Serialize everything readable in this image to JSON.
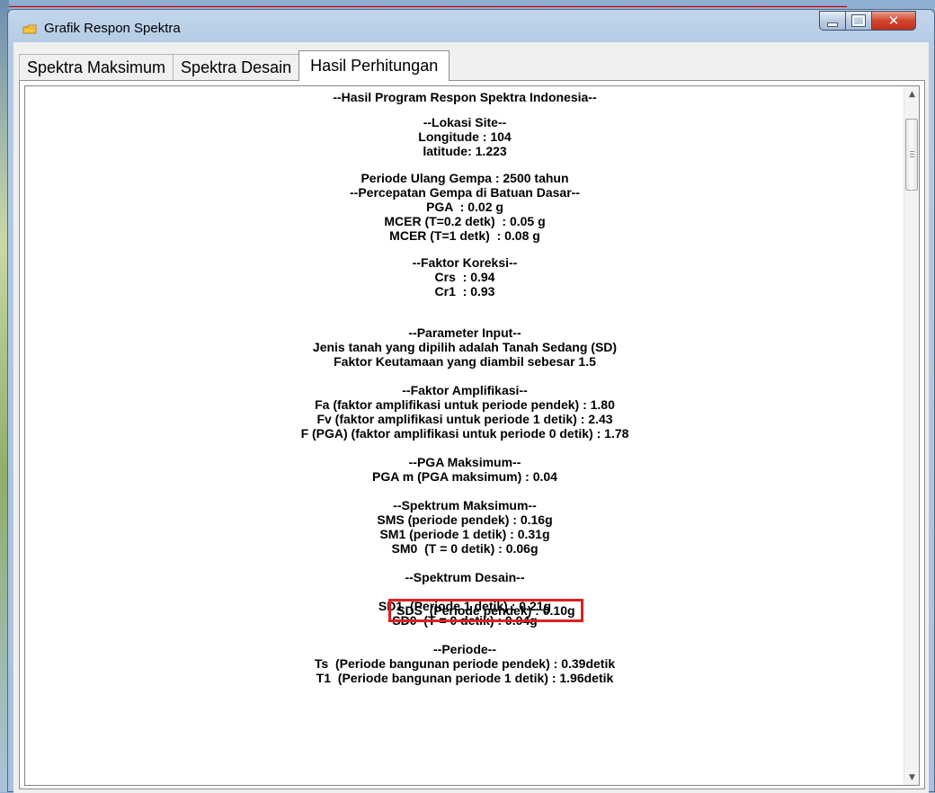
{
  "window": {
    "title": "Grafik Respon Spektra"
  },
  "tabs": [
    {
      "label": "Spektra Maksimum"
    },
    {
      "label": "Spektra Desain"
    },
    {
      "label": "Hasil Perhitungan"
    }
  ],
  "results": {
    "header": "--Hasil Program Respon Spektra Indonesia--",
    "lokasi_heading": "--Lokasi Site--",
    "longitude": "Longitude : 104",
    "latitude": "latitude: 1.223",
    "periode_ulang": "Periode Ulang Gempa : 2500 tahun",
    "percepatan_heading": "--Percepatan Gempa di Batuan Dasar--",
    "pga": "PGA  : 0.02 g",
    "mcer_02": "MCER (T=0.2 detk)  : 0.05 g",
    "mcer_1": "MCER (T=1 detk)  : 0.08 g",
    "koreksi_heading": "--Faktor Koreksi--",
    "crs": "Crs  : 0.94",
    "cr1": "Cr1  : 0.93",
    "input_heading": "--Parameter Input--",
    "jenis_tanah": "Jenis tanah yang dipilih adalah Tanah Sedang (SD)",
    "faktor_keutamaan": "Faktor Keutamaan yang diambil sebesar 1.5",
    "amplifikasi_heading": "--Faktor Amplifikasi--",
    "fa": "Fa (faktor amplifikasi untuk periode pendek) : 1.80",
    "fv": "Fv (faktor amplifikasi untuk periode 1 detik) : 2.43",
    "fpga": "F (PGA) (faktor amplifikasi untuk periode 0 detik) : 1.78",
    "pga_maks_heading": "--PGA Maksimum--",
    "pga_m": "PGA m (PGA maksimum) : 0.04",
    "spektrum_maks_heading": "--Spektrum Maksimum--",
    "sms": "SMS (periode pendek) : 0.16g",
    "sm1": "SM1 (periode 1 detik) : 0.31g",
    "sm0": "SM0  (T = 0 detik) : 0.06g",
    "spektrum_desain_heading": "--Spektrum Desain--",
    "sds": "SDS  (Periode pendek) : 0.10g",
    "sd1": "SD1  (Periode 1 detik) : 0.21g",
    "sd0": "SD0  (T = 0 detik) : 0.04g",
    "periode_heading": "--Periode--",
    "ts": "Ts  (Periode bangunan periode pendek) : 0.39detik",
    "t1": "T1  (Periode bangunan periode 1 detik) : 1.96detik"
  },
  "colors": {
    "highlight_box": "#e02020",
    "close_button": "#c9402a"
  }
}
